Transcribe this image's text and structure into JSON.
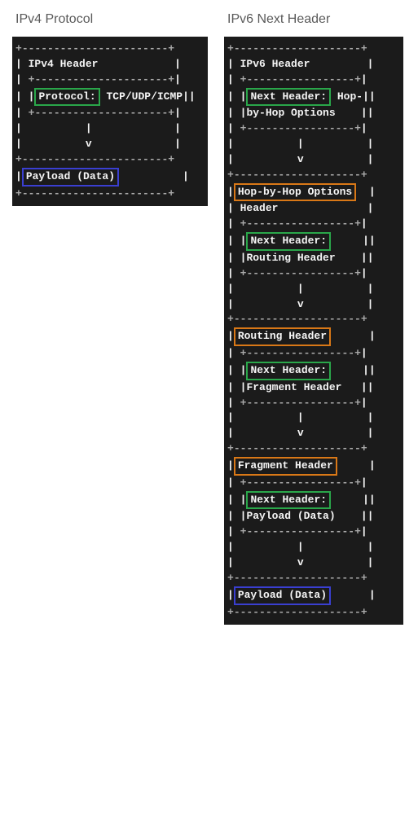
{
  "left": {
    "title": "IPv4 Protocol",
    "header_label": "IPv4 Header",
    "field_label": "Protocol:",
    "field_value": "TCP/UDP/ICMP",
    "payload_label": "Payload (Data)"
  },
  "right": {
    "title": "IPv6 Next Header",
    "blocks": [
      {
        "header_label": "IPv6 Header",
        "header_hl": "none",
        "field_label": "Next Header:",
        "field_rest_a": "Hop-",
        "field_rest_b": "by-Hop Options"
      },
      {
        "header_label": "Hop-by-Hop Options",
        "header_hl": "orange",
        "header_sub": "Header",
        "field_label": "Next Header:",
        "field_rest_a": "",
        "field_rest_b": "Routing Header"
      },
      {
        "header_label": "Routing Header",
        "header_hl": "orange",
        "field_label": "Next Header:",
        "field_rest_a": "",
        "field_rest_b": "Fragment Header"
      },
      {
        "header_label": "Fragment Header",
        "header_hl": "orange",
        "field_label": "Next Header:",
        "field_rest_a": "",
        "field_rest_b": "Payload (Data)"
      }
    ],
    "payload_label": "Payload (Data)"
  },
  "colors": {
    "bg": "#1b1b1b",
    "green": "#2aa74a",
    "orange": "#d97817",
    "blue": "#3a3fd1"
  }
}
